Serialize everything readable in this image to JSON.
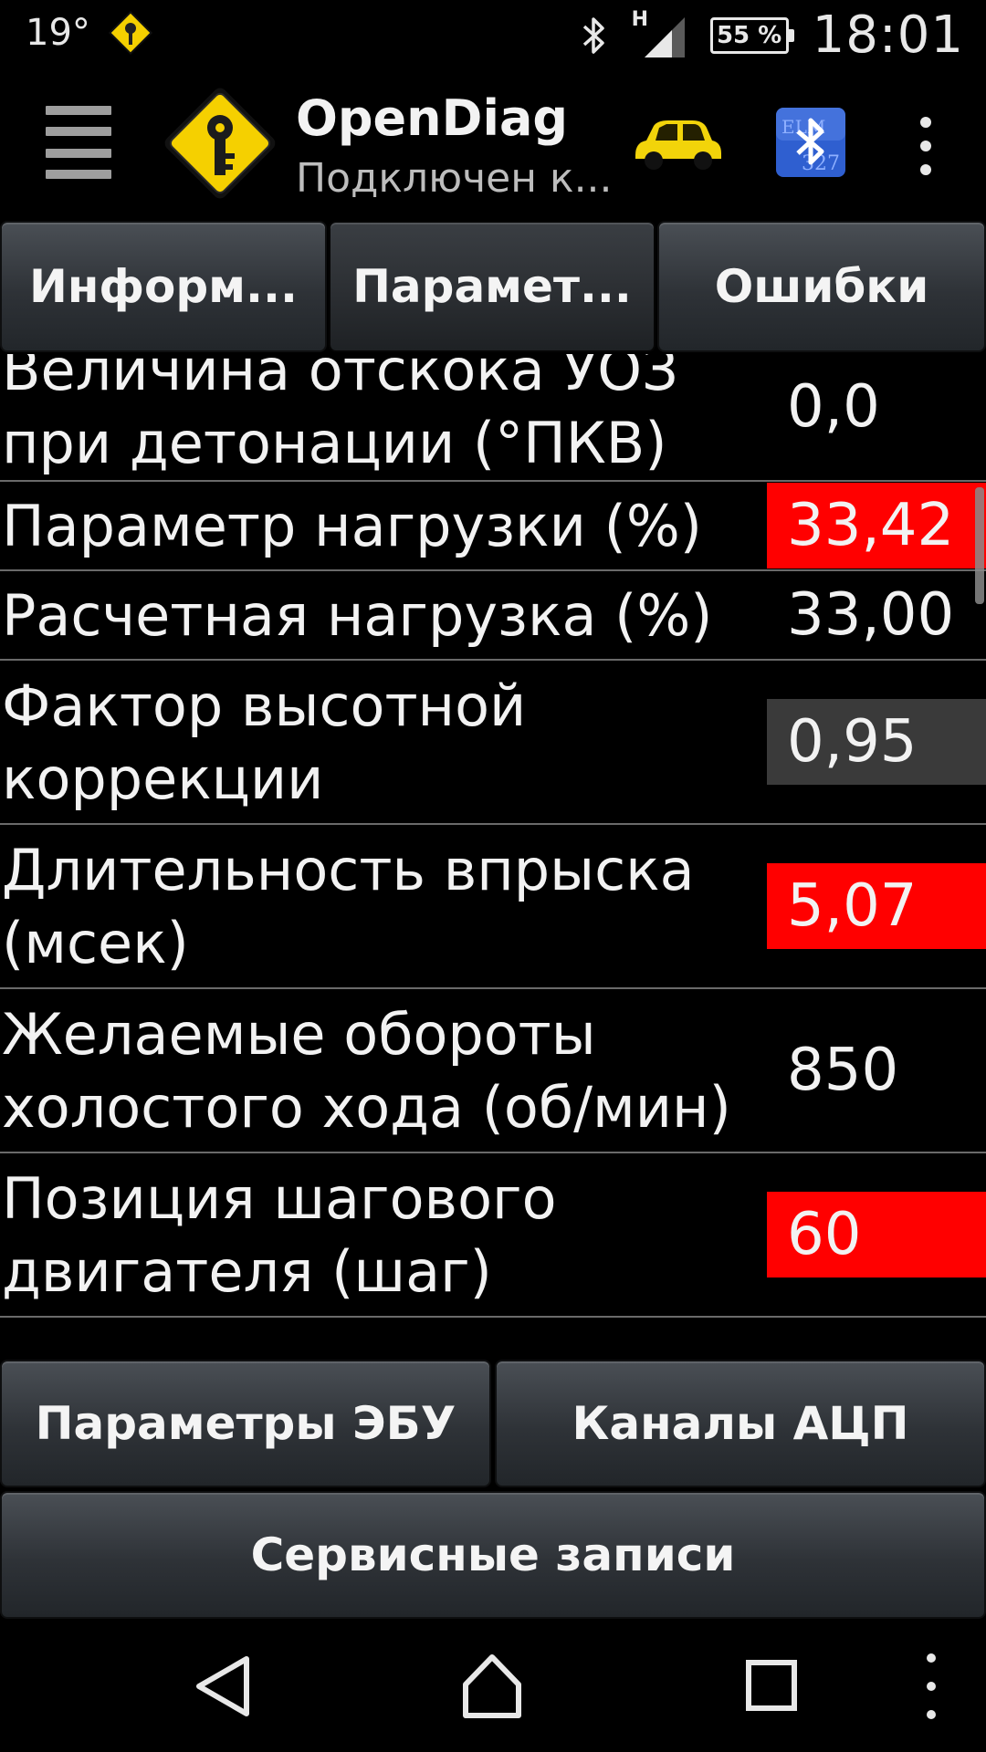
{
  "status_bar": {
    "temperature": "19°",
    "battery": "55 %",
    "battery_level": 0.55,
    "network_type": "H",
    "time": "18:01"
  },
  "action_bar": {
    "title": "OpenDiag",
    "subtitle": "Подключен к...",
    "menu_icon": "hamburger-menu-icon",
    "logo_icon": "key-diamond-logo-icon",
    "car_icon": "car-icon",
    "bluetooth_icon": "bluetooth-elm327-icon",
    "overflow_icon": "overflow-menu-icon"
  },
  "tabs": [
    {
      "label": "Информ...",
      "active": false
    },
    {
      "label": "Парамет...",
      "active": true
    },
    {
      "label": "Ошибки",
      "active": false
    }
  ],
  "parameters": [
    {
      "label_lines": [
        "Величина отскока УОЗ",
        "при детонации (°ПКВ)"
      ],
      "value": "0,0",
      "highlight": "none"
    },
    {
      "label_lines": [
        "Параметр нагрузки (%)"
      ],
      "value": "33,42",
      "highlight": "red"
    },
    {
      "label_lines": [
        "Расчетная нагрузка (%)"
      ],
      "value": "33,00",
      "highlight": "none"
    },
    {
      "label_lines": [
        "Фактор высотной",
        "коррекции"
      ],
      "value": "0,95",
      "highlight": "gray"
    },
    {
      "label_lines": [
        "Длительность впрыска",
        "(мсек)"
      ],
      "value": "5,07",
      "highlight": "red"
    },
    {
      "label_lines": [
        "Желаемые обороты",
        "холостого хода (об/мин)"
      ],
      "value": "850",
      "highlight": "none"
    },
    {
      "label_lines": [
        "Позиция шагового",
        "двигателя (шаг)"
      ],
      "value": "60",
      "highlight": "red"
    }
  ],
  "bottom_buttons": {
    "ecu_params": "Параметры ЭБУ",
    "adc_channels": "Каналы АЦП",
    "service_records": "Сервисные записи"
  },
  "colors": {
    "highlight_red": "#ff0000",
    "highlight_gray": "#3a3a3a",
    "logo_yellow": "#f5d000",
    "car_yellow": "#f2d40a",
    "bluetooth_blue": "#2f5fd0"
  },
  "nav_bar": {
    "back_icon": "back-triangle-icon",
    "home_icon": "home-icon",
    "recents_icon": "recents-square-icon",
    "menu_icon": "nav-overflow-icon"
  }
}
